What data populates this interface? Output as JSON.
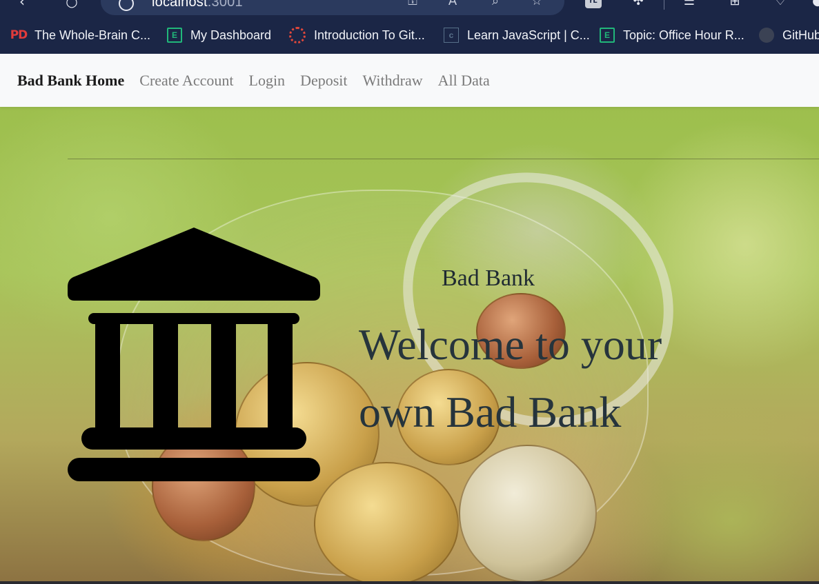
{
  "browser": {
    "url_host": "localhost",
    "url_port": ":3001",
    "toolbar_icons": [
      "back-icon",
      "refresh-icon",
      "info-icon",
      "key-icon",
      "read-aloud-icon",
      "zoom-icon",
      "favorite-star-icon",
      "extension-badge-icon",
      "extensions-puzzle-icon",
      "favorites-list-icon",
      "collections-icon",
      "performance-icon",
      "profile-icon"
    ]
  },
  "bookmarks": [
    {
      "label": "The Whole-Brain C...",
      "icon": "pd-icon"
    },
    {
      "label": "My Dashboard",
      "icon": "e-square-icon"
    },
    {
      "label": "Introduction To Git...",
      "icon": "canvas-icon"
    },
    {
      "label": "Learn JavaScript | C...",
      "icon": "codecademy-icon"
    },
    {
      "label": "Topic: Office Hour R...",
      "icon": "e-square-icon"
    },
    {
      "label": "GitHub",
      "icon": "github-icon"
    }
  ],
  "navbar": {
    "brand": "Bad Bank Home",
    "links": [
      "Create Account",
      "Login",
      "Deposit",
      "Withdraw",
      "All Data"
    ]
  },
  "hero": {
    "subtitle": "Bad Bank",
    "title": "Welcome to your own Bad Bank",
    "icon": "bank-icon"
  },
  "colors": {
    "chrome_bg": "#1b2646",
    "navbar_bg": "#f8f9fa",
    "brand_text": "#1b1b1b",
    "nav_link": "#7a7a7a",
    "hero_title": "#26343c"
  }
}
